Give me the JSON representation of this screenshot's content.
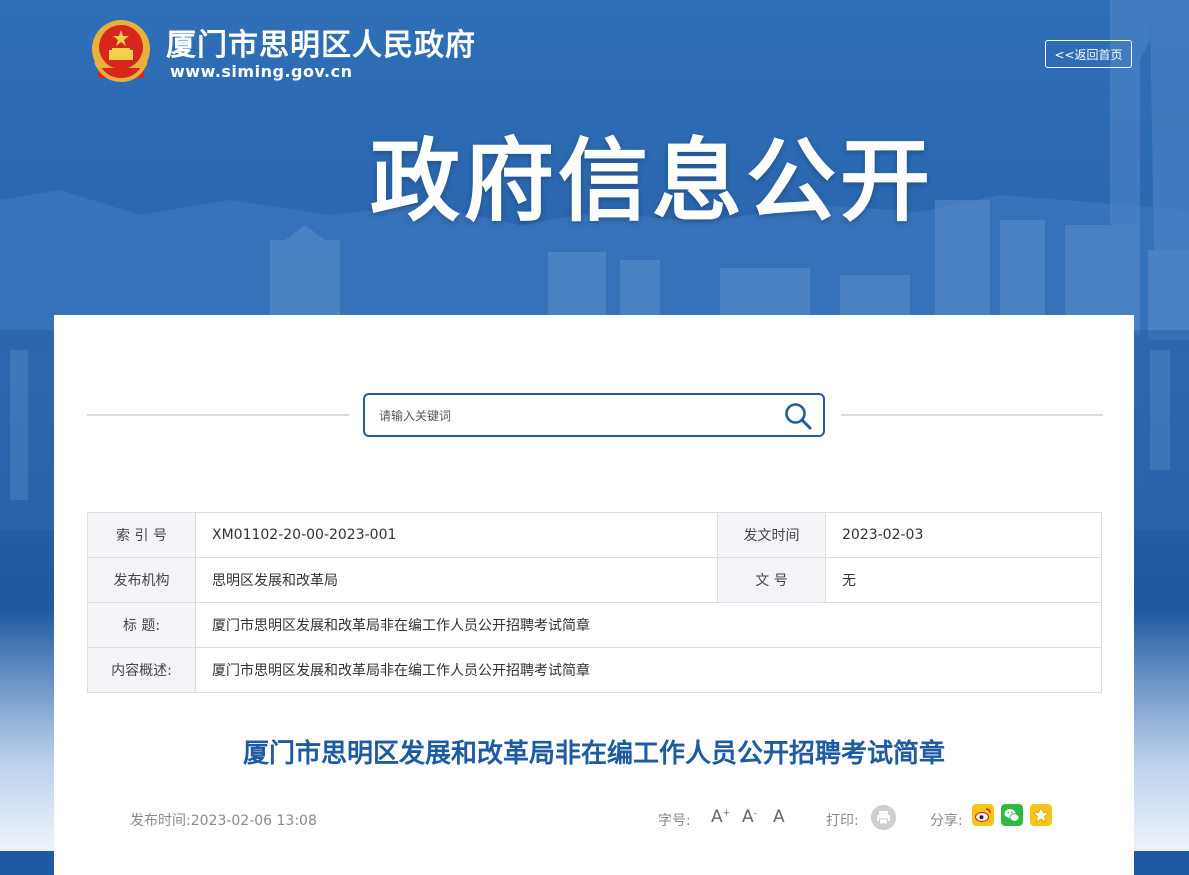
{
  "header": {
    "site_name": "厦门市思明区人民政府",
    "site_url": "www.siming.gov.cn",
    "back_home": "<<返回首页",
    "banner_title": "政府信息公开"
  },
  "search": {
    "placeholder": "请输入关键词"
  },
  "meta_table": {
    "index_label": "索 引 号",
    "index_value": "XM01102-20-00-2023-001",
    "date_label": "发文时间",
    "date_value": "2023-02-03",
    "org_label": "发布机构",
    "org_value": "思明区发展和改革局",
    "docno_label": "文 号",
    "docno_value": "无",
    "title_label": "标 题:",
    "title_value": "厦门市思明区发展和改革局非在编工作人员公开招聘考试简章",
    "summary_label": "内容概述:",
    "summary_value": "厦门市思明区发展和改革局非在编工作人员公开招聘考试简章"
  },
  "article": {
    "title": "厦门市思明区发展和改革局非在编工作人员公开招聘考试简章",
    "publish_time": "发布时间:2023-02-06 13:08",
    "font_size_label": "字号:",
    "print_label": "打印:",
    "share_label": "分享:"
  },
  "colors": {
    "brand_blue": "#1f5ba3",
    "table_label_bg": "#f2f4f7"
  }
}
